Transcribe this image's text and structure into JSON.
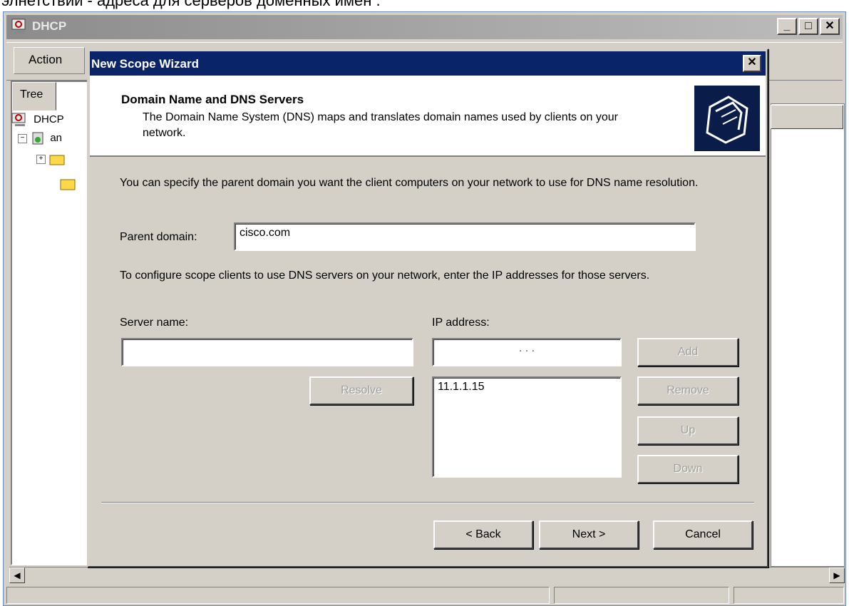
{
  "caption": "элнетствии - адреса для серверов доменных имен .",
  "main_window": {
    "title": "DHCP",
    "menu_action": "Action",
    "tree_tab": "Tree",
    "tree_root": "DHCP",
    "tree_server": "an"
  },
  "wizard": {
    "title": "New Scope Wizard",
    "header_title": "Domain Name and DNS Servers",
    "header_desc": "The Domain Name System (DNS) maps and translates domain names used by clients on your network.",
    "intro": "You can specify the parent domain you want the client computers on your network to use for DNS name resolution.",
    "parent_domain_label": "Parent domain:",
    "parent_domain_value": "cisco.com",
    "dns_instructions": "To configure scope clients to use DNS servers on your network, enter the IP addresses for those servers.",
    "server_name_label": "Server name:",
    "server_name_value": "",
    "ip_label": "IP address:",
    "ip_value": ".       .       .",
    "resolve_label": "Resolve",
    "ip_list": [
      "11.1.1.15"
    ],
    "add_label": "Add",
    "remove_label": "Remove",
    "up_label": "Up",
    "down_label": "Down",
    "back_label": "< Back",
    "next_label": "Next >",
    "cancel_label": "Cancel"
  },
  "colors": {
    "wizard_title": "#0a246a",
    "face": "#d4d0c8"
  }
}
